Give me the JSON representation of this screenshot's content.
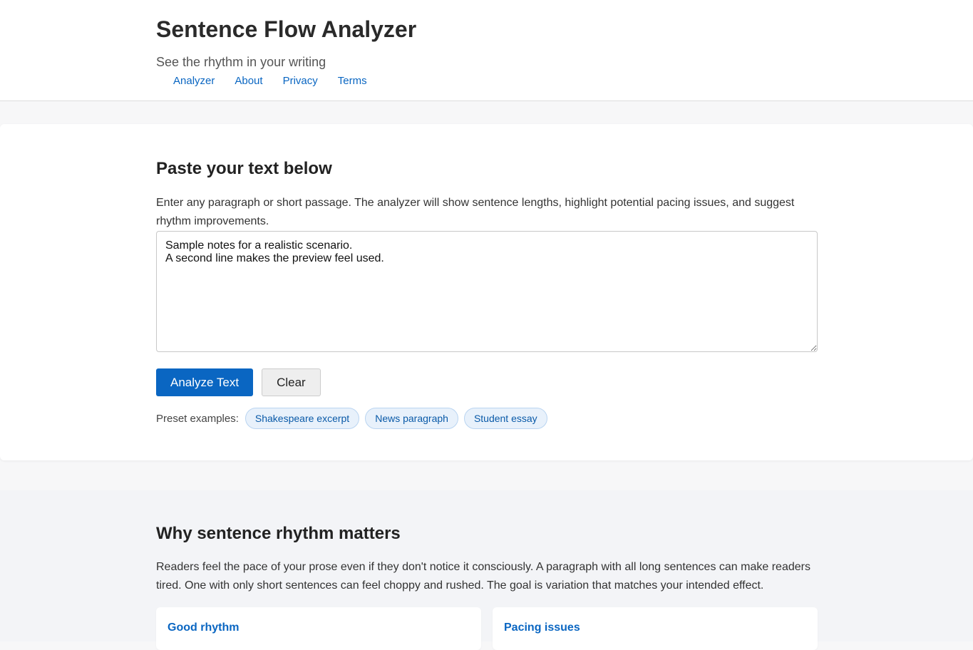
{
  "header": {
    "title": "Sentence Flow Analyzer",
    "tagline": "See the rhythm in your writing",
    "nav": [
      {
        "label": "Analyzer"
      },
      {
        "label": "About"
      },
      {
        "label": "Privacy"
      },
      {
        "label": "Terms"
      }
    ]
  },
  "input_section": {
    "heading": "Paste your text below",
    "intro": "Enter any paragraph or short passage. The analyzer will show sentence lengths, highlight potential pacing issues, and suggest rhythm improvements.",
    "textarea_value": "Sample notes for a realistic scenario.\nA second line makes the preview feel used.",
    "analyze_label": "Analyze Text",
    "clear_label": "Clear",
    "presets_label": "Preset examples:",
    "presets": [
      {
        "label": "Shakespeare excerpt"
      },
      {
        "label": "News paragraph"
      },
      {
        "label": "Student essay"
      }
    ]
  },
  "why_section": {
    "heading": "Why sentence rhythm matters",
    "text": "Readers feel the pace of your prose even if they don't notice it consciously. A paragraph with all long sentences can make readers tired. One with only short sentences can feel choppy and rushed. The goal is variation that matches your intended effect.",
    "cards": [
      {
        "title": "Good rhythm"
      },
      {
        "title": "Pacing issues"
      }
    ]
  },
  "colors": {
    "accent": "#0a66c2",
    "chip_bg": "#e8f1fb",
    "page_bg": "#f7f7f8"
  }
}
